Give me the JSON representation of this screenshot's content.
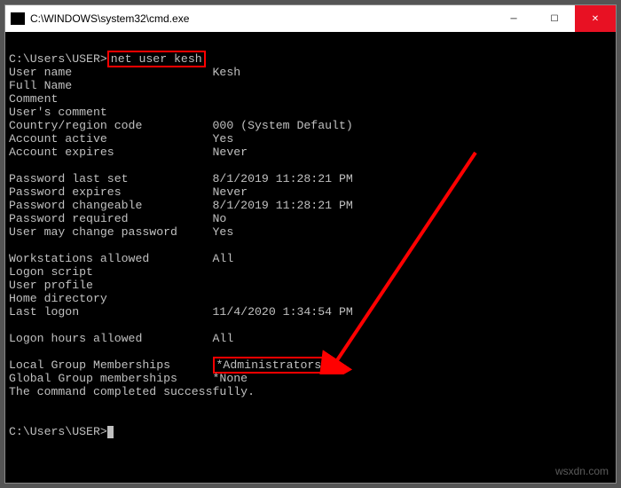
{
  "window": {
    "title": "C:\\WINDOWS\\system32\\cmd.exe"
  },
  "prompt1_path": "C:\\Users\\USER>",
  "command": "net user kesh",
  "fields": {
    "user_name_label": "User name",
    "user_name_value": "Kesh",
    "full_name_label": "Full Name",
    "comment_label": "Comment",
    "users_comment_label": "User's comment",
    "country_label": "Country/region code",
    "country_value": "000 (System Default)",
    "account_active_label": "Account active",
    "account_active_value": "Yes",
    "account_expires_label": "Account expires",
    "account_expires_value": "Never",
    "pw_last_set_label": "Password last set",
    "pw_last_set_value": "8/1/2019 11:28:21 PM",
    "pw_expires_label": "Password expires",
    "pw_expires_value": "Never",
    "pw_changeable_label": "Password changeable",
    "pw_changeable_value": "8/1/2019 11:28:21 PM",
    "pw_required_label": "Password required",
    "pw_required_value": "No",
    "user_may_change_label": "User may change password",
    "user_may_change_value": "Yes",
    "workstations_label": "Workstations allowed",
    "workstations_value": "All",
    "logon_script_label": "Logon script",
    "user_profile_label": "User profile",
    "home_dir_label": "Home directory",
    "last_logon_label": "Last logon",
    "last_logon_value": "11/4/2020 1:34:54 PM",
    "logon_hours_label": "Logon hours allowed",
    "logon_hours_value": "All",
    "local_group_label": "Local Group Memberships",
    "local_group_value": "*Administrators",
    "global_group_label": "Global Group memberships",
    "global_group_value": "*None",
    "completion": "The command completed successfully."
  },
  "prompt2": "C:\\Users\\USER>",
  "watermark": "wsxdn.com",
  "colors": {
    "highlight": "#ff0000",
    "titlebar_close": "#e81123"
  }
}
